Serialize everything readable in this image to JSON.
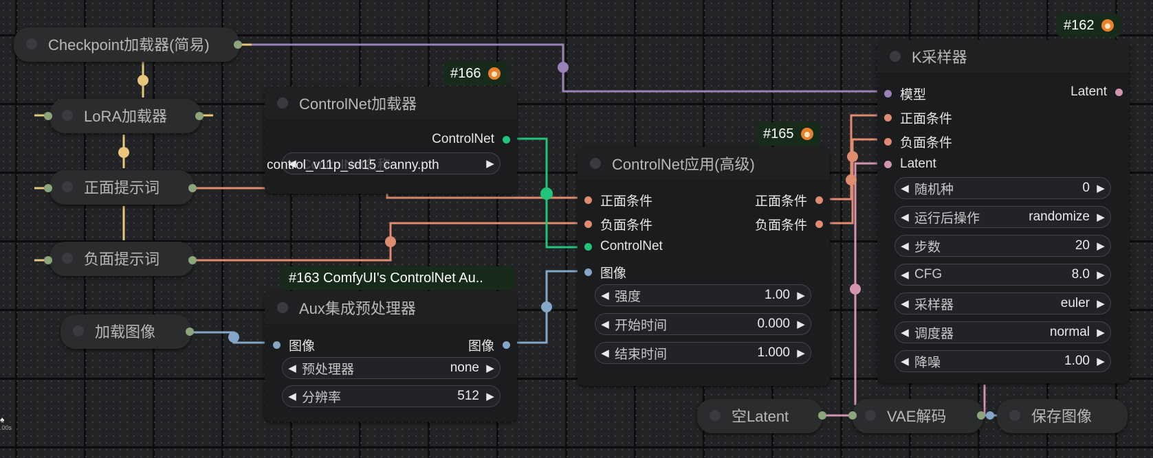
{
  "colors": {
    "model": "#9a82b8",
    "clip": "#e8c77c",
    "conditioning": "#e08c70",
    "controlnet": "#22c47a",
    "image": "#84a7c8",
    "latent": "#d494b0",
    "vae": "#e89ab6",
    "link_green": "#8da57a"
  },
  "nodes": {
    "checkpoint": {
      "title": "Checkpoint加载器(简易)"
    },
    "lora": {
      "title": "LoRA加载器"
    },
    "positive_prompt": {
      "title": "正面提示词"
    },
    "negative_prompt": {
      "title": "负面提示词"
    },
    "load_image": {
      "title": "加载图像"
    },
    "controlnet_loader": {
      "badge": "#166",
      "title": "ControlNet加载器",
      "output": "ControlNet",
      "widget_value": "control_v11p_sd15_canny.pth",
      "widget_overlap_label": "ControlNet名称"
    },
    "aux_preprocessor": {
      "badge": "#163 ComfyUI's ControlNet Au..",
      "title": "Aux集成预处理器",
      "input": "图像",
      "output": "图像",
      "widgets": [
        {
          "label": "预处理器",
          "value": "none"
        },
        {
          "label": "分辨率",
          "value": "512"
        }
      ]
    },
    "controlnet_apply": {
      "badge": "#165",
      "title": "ControlNet应用(高级)",
      "inputs": [
        "正面条件",
        "负面条件",
        "ControlNet",
        "图像"
      ],
      "outputs": [
        "正面条件",
        "负面条件"
      ],
      "widgets": [
        {
          "label": "强度",
          "value": "1.00"
        },
        {
          "label": "开始时间",
          "value": "0.000"
        },
        {
          "label": "结束时间",
          "value": "1.000"
        }
      ]
    },
    "ksampler": {
      "badge": "#162",
      "title": "K采样器",
      "inputs": [
        "模型",
        "正面条件",
        "负面条件",
        "Latent"
      ],
      "output": "Latent",
      "widgets": [
        {
          "label": "随机种",
          "value": "0"
        },
        {
          "label": "运行后操作",
          "value": "randomize"
        },
        {
          "label": "步数",
          "value": "20"
        },
        {
          "label": "CFG",
          "value": "8.0"
        },
        {
          "label": "采样器",
          "value": "euler"
        },
        {
          "label": "调度器",
          "value": "normal"
        },
        {
          "label": "降噪",
          "value": "1.00"
        }
      ]
    },
    "empty_latent": {
      "title": "空Latent"
    },
    "vae_decode": {
      "title": "VAE解码"
    },
    "save_image": {
      "title": "保存图像"
    }
  },
  "corner_text": ".00s"
}
